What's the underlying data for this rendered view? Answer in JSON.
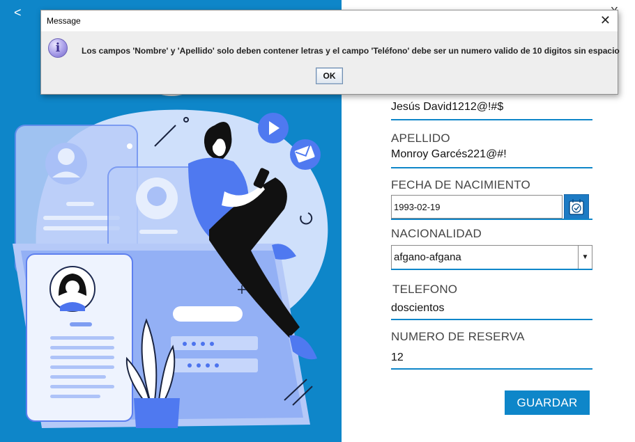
{
  "window": {
    "back_label": "<",
    "close_label": "X"
  },
  "form": {
    "nombre_value": "Jesús David1212@!#$",
    "apellido_label": "APELLIDO",
    "apellido_value": "Monroy Garcés221@#!",
    "fecha_label": "FECHA DE NACIMIENTO",
    "fecha_value": "1993-02-19",
    "nacionalidad_label": "NACIONALIDAD",
    "nacionalidad_value": "afgano-afgana",
    "telefono_label": "TELEFONO",
    "telefono_value": "doscientos",
    "reserva_label": "NUMERO DE RESERVA",
    "reserva_value": "12",
    "save_label": "GUARDAR"
  },
  "dialog": {
    "title": "Message",
    "close_label": "✕",
    "icon": "info-icon",
    "icon_glyph": "i",
    "message": "Los campos 'Nombre' y 'Apellido' solo deben contener letras y el campo 'Teléfono' debe ser un numero valido de 10 digitos sin espacio",
    "ok_label": "OK"
  },
  "colors": {
    "accent": "#0e86c9",
    "illustration_light": "#c9d8fb",
    "illustration_mid": "#4f79f0"
  }
}
